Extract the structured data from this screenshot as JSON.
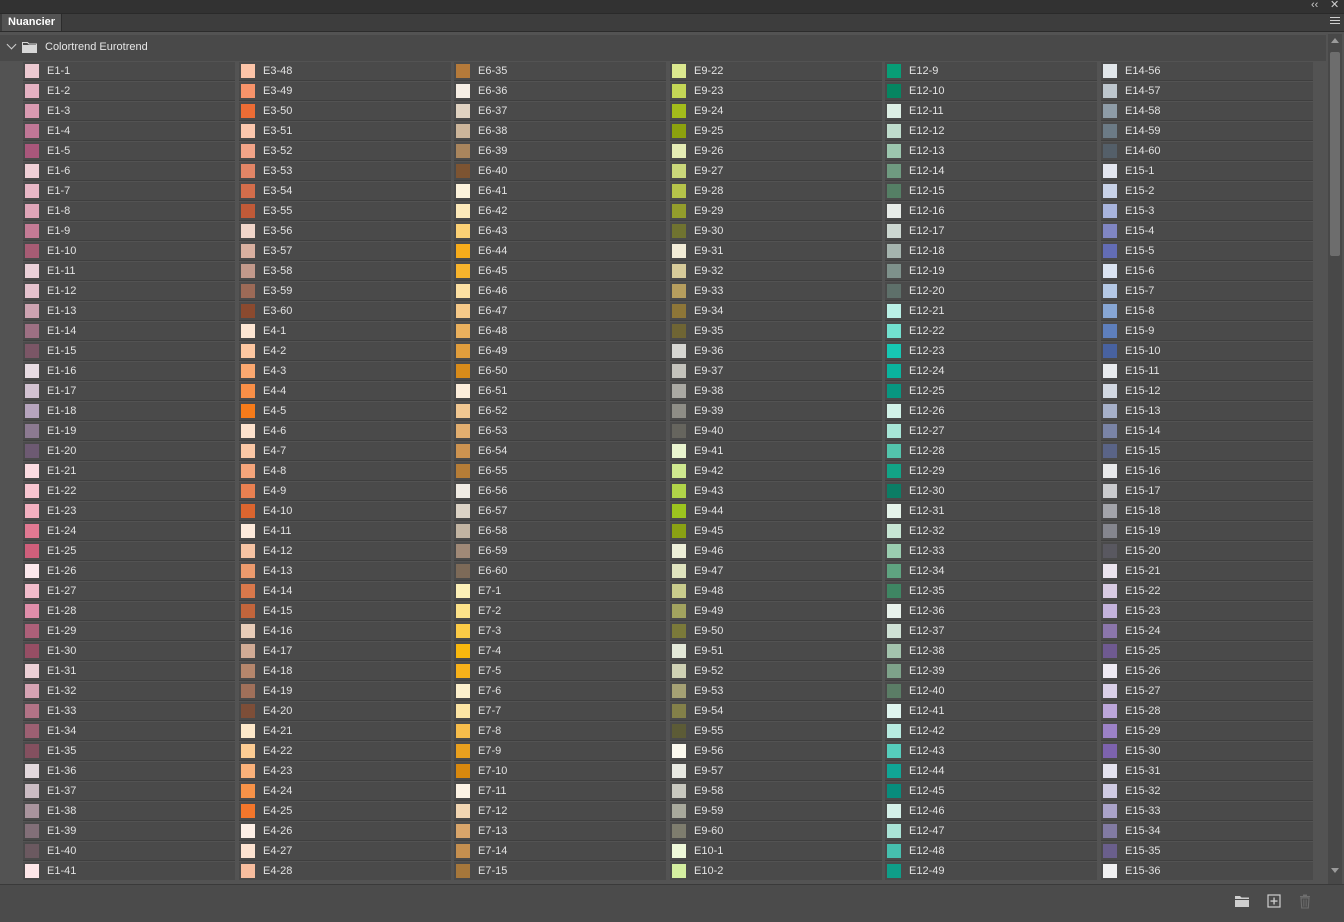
{
  "panel": {
    "tab_label": "Nuancier"
  },
  "icons": [
    "collapse-arrows-icon",
    "close-icon",
    "panel-menu-icon",
    "chevron-down-icon",
    "folder-icon",
    "new-group-icon",
    "new-swatch-icon",
    "trash-icon"
  ],
  "titlebar": {
    "collapse_glyph": "‹‹",
    "close_glyph": "✕"
  },
  "group": {
    "name": "Colortrend Eurotrend"
  },
  "columns": [
    [
      {
        "label": "E1-1",
        "color": "#ecc9d1"
      },
      {
        "label": "E1-2",
        "color": "#e4b1c2"
      },
      {
        "label": "E1-3",
        "color": "#d99ab1"
      },
      {
        "label": "E1-4",
        "color": "#c07796"
      },
      {
        "label": "E1-5",
        "color": "#a9577b"
      },
      {
        "label": "E1-6",
        "color": "#efcfd6"
      },
      {
        "label": "E1-7",
        "color": "#e8b7c6"
      },
      {
        "label": "E1-8",
        "color": "#dfa5b8"
      },
      {
        "label": "E1-9",
        "color": "#c47b95"
      },
      {
        "label": "E1-10",
        "color": "#a75c74"
      },
      {
        "label": "E1-11",
        "color": "#ead0d8"
      },
      {
        "label": "E1-12",
        "color": "#e5c2cd"
      },
      {
        "label": "E1-13",
        "color": "#cda3b1"
      },
      {
        "label": "E1-14",
        "color": "#9d7083"
      },
      {
        "label": "E1-15",
        "color": "#7b5666"
      },
      {
        "label": "E1-16",
        "color": "#e7dbe2"
      },
      {
        "label": "E1-17",
        "color": "#d2c2d1"
      },
      {
        "label": "E1-18",
        "color": "#b6a4bd"
      },
      {
        "label": "E1-19",
        "color": "#8c7a91"
      },
      {
        "label": "E1-20",
        "color": "#6d5a72"
      },
      {
        "label": "E1-21",
        "color": "#fbdbe1"
      },
      {
        "label": "E1-22",
        "color": "#f8c5d0"
      },
      {
        "label": "E1-23",
        "color": "#f3b0c0"
      },
      {
        "label": "E1-24",
        "color": "#e17992"
      },
      {
        "label": "E1-25",
        "color": "#cf5f7b"
      },
      {
        "label": "E1-26",
        "color": "#fce8ec"
      },
      {
        "label": "E1-27",
        "color": "#f2bccb"
      },
      {
        "label": "E1-28",
        "color": "#e08eaa"
      },
      {
        "label": "E1-29",
        "color": "#ad6079"
      },
      {
        "label": "E1-30",
        "color": "#964e64"
      },
      {
        "label": "E1-31",
        "color": "#ecd0d6"
      },
      {
        "label": "E1-32",
        "color": "#d6a3b3"
      },
      {
        "label": "E1-33",
        "color": "#b27386"
      },
      {
        "label": "E1-34",
        "color": "#9c6072"
      },
      {
        "label": "E1-35",
        "color": "#84505f"
      },
      {
        "label": "E1-36",
        "color": "#e2d8dc"
      },
      {
        "label": "E1-37",
        "color": "#cbbcc3"
      },
      {
        "label": "E1-38",
        "color": "#a9949d"
      },
      {
        "label": "E1-39",
        "color": "#826f78"
      },
      {
        "label": "E1-40",
        "color": "#6b5960"
      },
      {
        "label": "E1-41",
        "color": "#fde6e8"
      }
    ],
    [
      {
        "label": "E3-48",
        "color": "#fcc4a8"
      },
      {
        "label": "E3-49",
        "color": "#f7936a"
      },
      {
        "label": "E3-50",
        "color": "#ec6c35"
      },
      {
        "label": "E3-51",
        "color": "#fbc7ad"
      },
      {
        "label": "E3-52",
        "color": "#f2a488"
      },
      {
        "label": "E3-53",
        "color": "#e28566"
      },
      {
        "label": "E3-54",
        "color": "#d36d4b"
      },
      {
        "label": "E3-55",
        "color": "#c05a38"
      },
      {
        "label": "E3-56",
        "color": "#f0d5c9"
      },
      {
        "label": "E3-57",
        "color": "#d9b0a0"
      },
      {
        "label": "E3-58",
        "color": "#c2998b"
      },
      {
        "label": "E3-59",
        "color": "#9c6a57"
      },
      {
        "label": "E3-60",
        "color": "#8b4a2f"
      },
      {
        "label": "E4-1",
        "color": "#fde6d3"
      },
      {
        "label": "E4-2",
        "color": "#fdc7a1"
      },
      {
        "label": "E4-3",
        "color": "#fba870"
      },
      {
        "label": "E4-4",
        "color": "#f98f47"
      },
      {
        "label": "E4-5",
        "color": "#f67b1a"
      },
      {
        "label": "E4-6",
        "color": "#fde2cd"
      },
      {
        "label": "E4-7",
        "color": "#fbc8a6"
      },
      {
        "label": "E4-8",
        "color": "#f5a57b"
      },
      {
        "label": "E4-9",
        "color": "#e98051"
      },
      {
        "label": "E4-10",
        "color": "#db652f"
      },
      {
        "label": "E4-11",
        "color": "#fdeadb"
      },
      {
        "label": "E4-12",
        "color": "#f6c3a3"
      },
      {
        "label": "E4-13",
        "color": "#ec9a6d"
      },
      {
        "label": "E4-14",
        "color": "#d9784b"
      },
      {
        "label": "E4-15",
        "color": "#c2653c"
      },
      {
        "label": "E4-16",
        "color": "#e8cdb9"
      },
      {
        "label": "E4-17",
        "color": "#d1ab95"
      },
      {
        "label": "E4-18",
        "color": "#b5866c"
      },
      {
        "label": "E4-19",
        "color": "#a0705a"
      },
      {
        "label": "E4-20",
        "color": "#7d4e38"
      },
      {
        "label": "E4-21",
        "color": "#fde8c9"
      },
      {
        "label": "E4-22",
        "color": "#fccc93"
      },
      {
        "label": "E4-23",
        "color": "#fab17a"
      },
      {
        "label": "E4-24",
        "color": "#f79248"
      },
      {
        "label": "E4-25",
        "color": "#f3762b"
      },
      {
        "label": "E4-26",
        "color": "#fdefe6"
      },
      {
        "label": "E4-27",
        "color": "#fde3d1"
      },
      {
        "label": "E4-28",
        "color": "#f7bd9e"
      }
    ],
    [
      {
        "label": "E6-35",
        "color": "#b57a3a"
      },
      {
        "label": "E6-36",
        "color": "#f6eee4"
      },
      {
        "label": "E6-37",
        "color": "#e0d2c1"
      },
      {
        "label": "E6-38",
        "color": "#ccb59a"
      },
      {
        "label": "E6-39",
        "color": "#a9855d"
      },
      {
        "label": "E6-40",
        "color": "#7d5432"
      },
      {
        "label": "E6-41",
        "color": "#fdf3dc"
      },
      {
        "label": "E6-42",
        "color": "#fde9b9"
      },
      {
        "label": "E6-43",
        "color": "#fcd175"
      },
      {
        "label": "E6-44",
        "color": "#f7ac1b"
      },
      {
        "label": "E6-45",
        "color": "#f8b42c"
      },
      {
        "label": "E6-46",
        "color": "#fde0a2"
      },
      {
        "label": "E6-47",
        "color": "#f6c988"
      },
      {
        "label": "E6-48",
        "color": "#eab05d"
      },
      {
        "label": "E6-49",
        "color": "#e09d3c"
      },
      {
        "label": "E6-50",
        "color": "#d88b1a"
      },
      {
        "label": "E6-51",
        "color": "#fdeedb"
      },
      {
        "label": "E6-52",
        "color": "#f1c791"
      },
      {
        "label": "E6-53",
        "color": "#e2ae6f"
      },
      {
        "label": "E6-54",
        "color": "#cd9350"
      },
      {
        "label": "E6-55",
        "color": "#b67d37"
      },
      {
        "label": "E6-56",
        "color": "#f0ebe3"
      },
      {
        "label": "E6-57",
        "color": "#dcd3c6"
      },
      {
        "label": "E6-58",
        "color": "#c2b4a2"
      },
      {
        "label": "E6-59",
        "color": "#a08977"
      },
      {
        "label": "E6-60",
        "color": "#7d6a58"
      },
      {
        "label": "E7-1",
        "color": "#fdf0b7"
      },
      {
        "label": "E7-2",
        "color": "#fde289"
      },
      {
        "label": "E7-3",
        "color": "#fccb46"
      },
      {
        "label": "E7-4",
        "color": "#f9b80e"
      },
      {
        "label": "E7-5",
        "color": "#f8b21a"
      },
      {
        "label": "E7-6",
        "color": "#fdf0cc"
      },
      {
        "label": "E7-7",
        "color": "#fde5a4"
      },
      {
        "label": "E7-8",
        "color": "#f7bd4b"
      },
      {
        "label": "E7-9",
        "color": "#e9a01e"
      },
      {
        "label": "E7-10",
        "color": "#d8880e"
      },
      {
        "label": "E7-11",
        "color": "#fdf3e4"
      },
      {
        "label": "E7-12",
        "color": "#f2d6b2"
      },
      {
        "label": "E7-13",
        "color": "#d9a56a"
      },
      {
        "label": "E7-14",
        "color": "#c58f4f"
      },
      {
        "label": "E7-15",
        "color": "#a6773b"
      }
    ],
    [
      {
        "label": "E9-22",
        "color": "#dbe88f"
      },
      {
        "label": "E9-23",
        "color": "#c4d656"
      },
      {
        "label": "E9-24",
        "color": "#a3bc1b"
      },
      {
        "label": "E9-25",
        "color": "#8ca10e"
      },
      {
        "label": "E9-26",
        "color": "#e4ebb4"
      },
      {
        "label": "E9-27",
        "color": "#cad77a"
      },
      {
        "label": "E9-28",
        "color": "#b5c34a"
      },
      {
        "label": "E9-29",
        "color": "#939d2c"
      },
      {
        "label": "E9-30",
        "color": "#707330"
      },
      {
        "label": "E9-31",
        "color": "#f2ecd7"
      },
      {
        "label": "E9-32",
        "color": "#d7cb9a"
      },
      {
        "label": "E9-33",
        "color": "#b69e5e"
      },
      {
        "label": "E9-34",
        "color": "#8d7638"
      },
      {
        "label": "E9-35",
        "color": "#6f6534"
      },
      {
        "label": "E9-36",
        "color": "#d6d6d2"
      },
      {
        "label": "E9-37",
        "color": "#c4c3bc"
      },
      {
        "label": "E9-38",
        "color": "#aaa9a3"
      },
      {
        "label": "E9-39",
        "color": "#8e8d86"
      },
      {
        "label": "E9-40",
        "color": "#66655e"
      },
      {
        "label": "E9-41",
        "color": "#e9f4cf"
      },
      {
        "label": "E9-42",
        "color": "#cfe88f"
      },
      {
        "label": "E9-43",
        "color": "#b1d449"
      },
      {
        "label": "E9-44",
        "color": "#9cc41f"
      },
      {
        "label": "E9-45",
        "color": "#8aa114"
      },
      {
        "label": "E9-46",
        "color": "#edefd8"
      },
      {
        "label": "E9-47",
        "color": "#dfe3be"
      },
      {
        "label": "E9-48",
        "color": "#c9cc8c"
      },
      {
        "label": "E9-49",
        "color": "#a2a35f"
      },
      {
        "label": "E9-50",
        "color": "#7b7a3a"
      },
      {
        "label": "E9-51",
        "color": "#e3e8d8"
      },
      {
        "label": "E9-52",
        "color": "#cfd1b4"
      },
      {
        "label": "E9-53",
        "color": "#a5a174"
      },
      {
        "label": "E9-54",
        "color": "#838049"
      },
      {
        "label": "E9-55",
        "color": "#5c5b36"
      },
      {
        "label": "E9-56",
        "color": "#fbf9ee"
      },
      {
        "label": "E9-57",
        "color": "#e8e9e2"
      },
      {
        "label": "E9-58",
        "color": "#c8c8bf"
      },
      {
        "label": "E9-59",
        "color": "#a8a99c"
      },
      {
        "label": "E9-60",
        "color": "#7e7d6e"
      },
      {
        "label": "E10-1",
        "color": "#eef8d9"
      },
      {
        "label": "E10-2",
        "color": "#d4eea0"
      }
    ],
    [
      {
        "label": "E12-9",
        "color": "#089d76"
      },
      {
        "label": "E12-10",
        "color": "#068561"
      },
      {
        "label": "E12-11",
        "color": "#dceee4"
      },
      {
        "label": "E12-12",
        "color": "#bfdccc"
      },
      {
        "label": "E12-13",
        "color": "#9cc6ae"
      },
      {
        "label": "E12-14",
        "color": "#6f9a80"
      },
      {
        "label": "E12-15",
        "color": "#557f65"
      },
      {
        "label": "E12-16",
        "color": "#e7ece8"
      },
      {
        "label": "E12-17",
        "color": "#ccd7d1"
      },
      {
        "label": "E12-18",
        "color": "#a5b4ae"
      },
      {
        "label": "E12-19",
        "color": "#7e918b"
      },
      {
        "label": "E12-20",
        "color": "#5e706a"
      },
      {
        "label": "E12-21",
        "color": "#b9f0e6"
      },
      {
        "label": "E12-22",
        "color": "#72e0cf"
      },
      {
        "label": "E12-23",
        "color": "#17c7b3"
      },
      {
        "label": "E12-24",
        "color": "#0ab39d"
      },
      {
        "label": "E12-25",
        "color": "#089680"
      },
      {
        "label": "E12-26",
        "color": "#d1f2e8"
      },
      {
        "label": "E12-27",
        "color": "#a7e6d7"
      },
      {
        "label": "E12-28",
        "color": "#53c4ac"
      },
      {
        "label": "E12-29",
        "color": "#12a386"
      },
      {
        "label": "E12-30",
        "color": "#0c7d65"
      },
      {
        "label": "E12-31",
        "color": "#e4f3ea"
      },
      {
        "label": "E12-32",
        "color": "#c7e6d4"
      },
      {
        "label": "E12-33",
        "color": "#9acdb0"
      },
      {
        "label": "E12-34",
        "color": "#5fa380"
      },
      {
        "label": "E12-35",
        "color": "#3f8663"
      },
      {
        "label": "E12-36",
        "color": "#e8f2ec"
      },
      {
        "label": "E12-37",
        "color": "#cfe1d5"
      },
      {
        "label": "E12-38",
        "color": "#a3c3ad"
      },
      {
        "label": "E12-39",
        "color": "#7ea28a"
      },
      {
        "label": "E12-40",
        "color": "#5b7d66"
      },
      {
        "label": "E12-41",
        "color": "#dff5ef"
      },
      {
        "label": "E12-42",
        "color": "#b7ebe0"
      },
      {
        "label": "E12-43",
        "color": "#56cdbc"
      },
      {
        "label": "E12-44",
        "color": "#10a595"
      },
      {
        "label": "E12-45",
        "color": "#088c7c"
      },
      {
        "label": "E12-46",
        "color": "#d4f0e9"
      },
      {
        "label": "E12-47",
        "color": "#a9e3d6"
      },
      {
        "label": "E12-48",
        "color": "#46bfae"
      },
      {
        "label": "E12-49",
        "color": "#0f9d88"
      }
    ],
    [
      {
        "label": "E14-56",
        "color": "#e1e6ea"
      },
      {
        "label": "E14-57",
        "color": "#bdc6cd"
      },
      {
        "label": "E14-58",
        "color": "#8e9ca7"
      },
      {
        "label": "E14-59",
        "color": "#6c7b86"
      },
      {
        "label": "E14-60",
        "color": "#545f69"
      },
      {
        "label": "E15-1",
        "color": "#e3e6ef"
      },
      {
        "label": "E15-2",
        "color": "#c8d2e8"
      },
      {
        "label": "E15-3",
        "color": "#a8b4dd"
      },
      {
        "label": "E15-4",
        "color": "#8086c3"
      },
      {
        "label": "E15-5",
        "color": "#636db5"
      },
      {
        "label": "E15-6",
        "color": "#dbe4f2"
      },
      {
        "label": "E15-7",
        "color": "#b4c8e5"
      },
      {
        "label": "E15-8",
        "color": "#87a6d4"
      },
      {
        "label": "E15-9",
        "color": "#5e7fbc"
      },
      {
        "label": "E15-10",
        "color": "#4862a0"
      },
      {
        "label": "E15-11",
        "color": "#e8ebee"
      },
      {
        "label": "E15-12",
        "color": "#d2d8e2"
      },
      {
        "label": "E15-13",
        "color": "#a6b0c9"
      },
      {
        "label": "E15-14",
        "color": "#7a84a6"
      },
      {
        "label": "E15-15",
        "color": "#5a6487"
      },
      {
        "label": "E15-16",
        "color": "#e8e9eb"
      },
      {
        "label": "E15-17",
        "color": "#cacbce"
      },
      {
        "label": "E15-18",
        "color": "#a3a4aa"
      },
      {
        "label": "E15-19",
        "color": "#85868e"
      },
      {
        "label": "E15-20",
        "color": "#595860"
      },
      {
        "label": "E15-21",
        "color": "#ebe4ee"
      },
      {
        "label": "E15-22",
        "color": "#d8cbe3"
      },
      {
        "label": "E15-23",
        "color": "#c4b3dc"
      },
      {
        "label": "E15-24",
        "color": "#8b76ab"
      },
      {
        "label": "E15-25",
        "color": "#6f5a91"
      },
      {
        "label": "E15-26",
        "color": "#eeeaf3"
      },
      {
        "label": "E15-27",
        "color": "#dad0e8"
      },
      {
        "label": "E15-28",
        "color": "#bca6da"
      },
      {
        "label": "E15-29",
        "color": "#9c82c7"
      },
      {
        "label": "E15-30",
        "color": "#7d63ae"
      },
      {
        "label": "E15-31",
        "color": "#e4e3ef"
      },
      {
        "label": "E15-32",
        "color": "#cfcbe3"
      },
      {
        "label": "E15-33",
        "color": "#aaa3c9"
      },
      {
        "label": "E15-34",
        "color": "#827ba3"
      },
      {
        "label": "E15-35",
        "color": "#6a5f8c"
      },
      {
        "label": "E15-36",
        "color": "#f0f0f1"
      }
    ]
  ]
}
